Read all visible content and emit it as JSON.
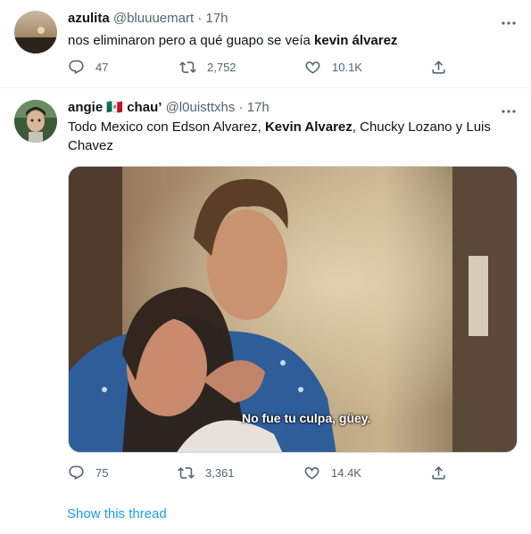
{
  "tweets": [
    {
      "name": "azulita",
      "handle": "@bluuuemart",
      "time": "17h",
      "text_parts": [
        "nos eliminaron pero a qué guapo se veía ",
        "kevin álvarez"
      ],
      "replies": "47",
      "retweets": "2,752",
      "likes": "10.1K"
    },
    {
      "name": "angie",
      "flag": "🇲🇽",
      "name_suffix": "chau’",
      "handle": "@l0uisttxhs",
      "time": "17h",
      "text_parts": [
        "Todo Mexico con Edson Alvarez, ",
        "Kevin Alvarez",
        ", Chucky Lozano y Luis Chavez"
      ],
      "media_caption": "No fue tu culpa, güey.",
      "replies": "75",
      "retweets": "3,361",
      "likes": "14.4K"
    }
  ],
  "separator": "·",
  "more_label": "···",
  "show_thread": "Show this thread",
  "colors": {
    "accent": "#1d9bf0",
    "secondary_text": "#536471",
    "primary_text": "#0f1419",
    "divider": "#eff3f4"
  },
  "icons": [
    "reply-icon",
    "retweet-icon",
    "like-icon",
    "share-icon",
    "more-icon"
  ]
}
